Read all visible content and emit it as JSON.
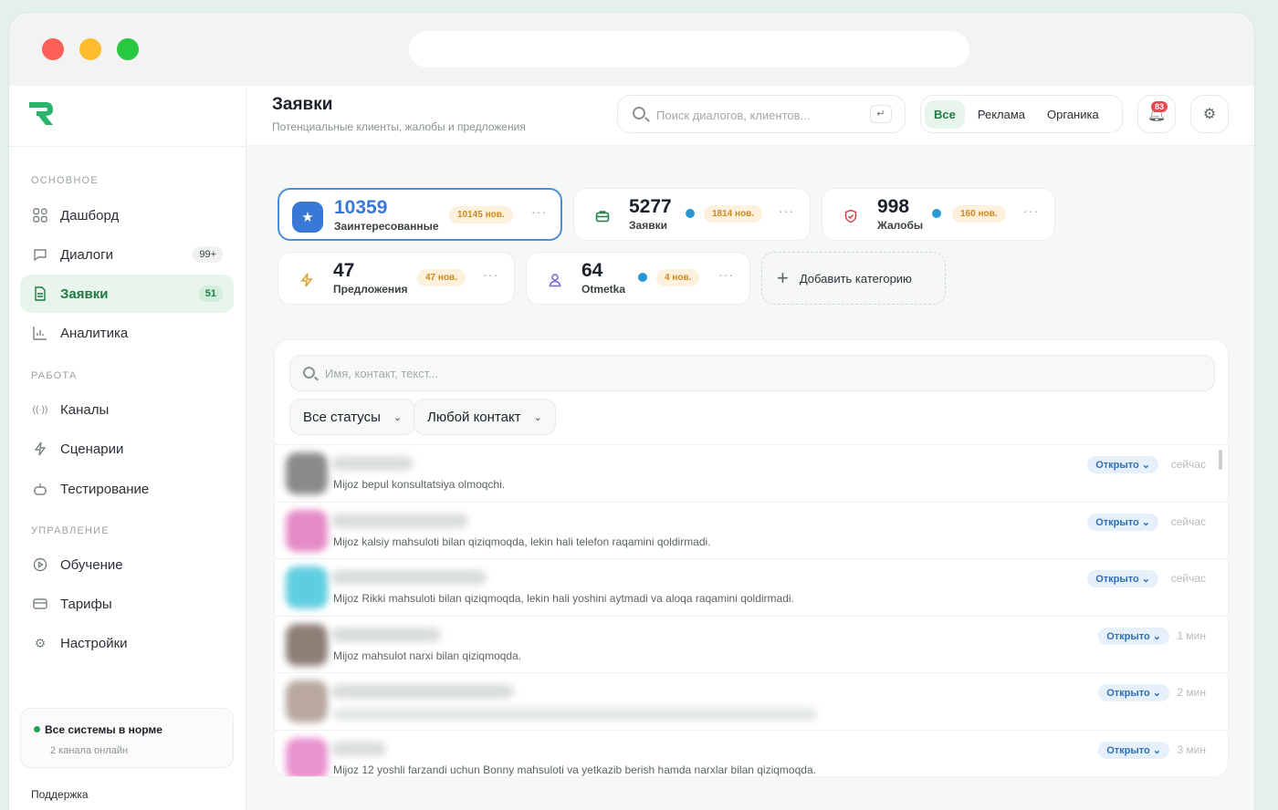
{
  "window": {
    "traffic_lights": [
      "close",
      "minimize",
      "zoom"
    ]
  },
  "sidebar": {
    "logo": "R",
    "sections": [
      {
        "title": "ОСНОВНОЕ"
      },
      {
        "title": "РАБОТА"
      },
      {
        "title": "УПРАВЛЕНИЕ"
      }
    ],
    "items": [
      {
        "label": "Дашборд",
        "icon": "grid-icon"
      },
      {
        "label": "Диалоги",
        "icon": "chat-icon",
        "badge": "99+"
      },
      {
        "label": "Заявки",
        "icon": "document-icon",
        "badge": "51",
        "active": true
      },
      {
        "label": "Аналитика",
        "icon": "bar-chart-icon"
      },
      {
        "label": "Каналы",
        "icon": "broadcast-icon"
      },
      {
        "label": "Сценарии",
        "icon": "lightning-icon"
      },
      {
        "label": "Тестирование",
        "icon": "bot-icon"
      },
      {
        "label": "Обучение",
        "icon": "play-circle-icon"
      },
      {
        "label": "Тарифы",
        "icon": "card-icon"
      },
      {
        "label": "Настройки",
        "icon": "gear-icon"
      }
    ],
    "status": {
      "title": "Все системы в норме",
      "subtitle": "2 канала онлайн"
    },
    "support": "Поддержка"
  },
  "header": {
    "title": "Заявки",
    "subtitle": "Потенциальные клиенты, жалобы и предложения",
    "search_placeholder": "Поиск диалогов, клиентов...",
    "enter_key": "↵",
    "segments": [
      "Все",
      "Реклама",
      "Органика"
    ],
    "active_segment": "Все",
    "notifications_count": "83"
  },
  "categories": [
    {
      "num": "10359",
      "label": "Заинтересованные",
      "new": "10145 нов.",
      "icon": "star-icon",
      "selected": true
    },
    {
      "num": "5277",
      "label": "Заявки",
      "new": "1814 нов.",
      "icon": "briefcase-icon",
      "telegram": true
    },
    {
      "num": "998",
      "label": "Жалобы",
      "new": "160 нов.",
      "icon": "shield-icon",
      "telegram": true
    },
    {
      "num": "47",
      "label": "Предложения",
      "new": "47 нов.",
      "icon": "lightning-icon"
    },
    {
      "num": "64",
      "label": "Otmetka",
      "new": "4 нов.",
      "icon": "user-icon",
      "telegram": true
    }
  ],
  "add_category": "Добавить категорию",
  "list": {
    "search_placeholder": "Имя, контакт, текст...",
    "filters": [
      "Все статусы",
      "Любой контакт"
    ],
    "rows": [
      {
        "avatar_color": "#8a8a8a",
        "name_w": 90,
        "message": "Mijoz bepul konsultatsiya olmoqchi.",
        "status": "Открыто",
        "time": "сейчас"
      },
      {
        "avatar_color": "#e58bc6",
        "name_w": 150,
        "message": "Mijoz kalsiy mahsuloti bilan qiziqmoqda, lekin hali telefon raqamini qoldirmadi.",
        "status": "Открыто",
        "time": "сейчас"
      },
      {
        "avatar_color": "#5fcde0",
        "name_w": 170,
        "message": "Mijoz Rikki mahsuloti bilan qiziqmoqda, lekin hali yoshini aytmadi va aloqa raqamini qoldirmadi.",
        "status": "Открыто",
        "time": "сейчас"
      },
      {
        "avatar_color": "#8e7f77",
        "name_w": 120,
        "message": "Mijoz mahsulot narxi bilan qiziqmoqda.",
        "status": "Открыто",
        "time": "1 мин"
      },
      {
        "avatar_color": "#b8a89f",
        "name_w": 200,
        "message": "",
        "status": "Открыто",
        "time": "2 мин"
      },
      {
        "avatar_color": "#e993cf",
        "name_w": 60,
        "message": "Mijoz 12 yoshli farzandi uchun Bonny mahsuloti va yetkazib berish hamda narxlar bilan qiziqmoqda.",
        "status": "Открыто",
        "time": "3 мин"
      }
    ]
  },
  "colors": {
    "accent": "#1f7a44",
    "selected_border": "#4a90d9",
    "new_badge": "#c98a1f",
    "status_badge": "#2d6fb8"
  }
}
